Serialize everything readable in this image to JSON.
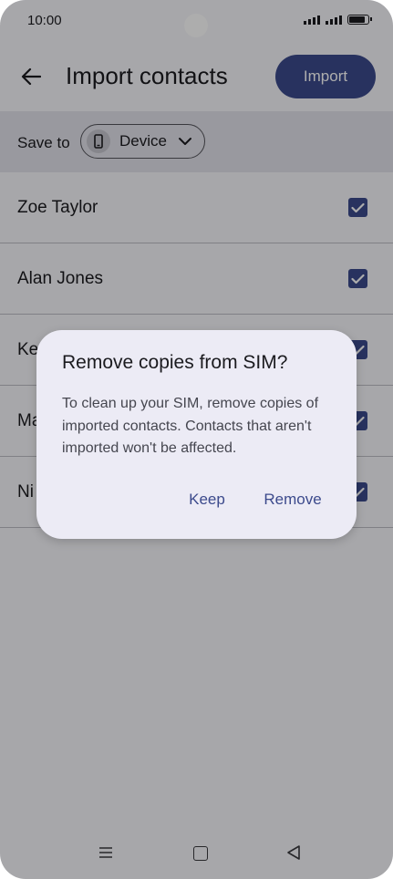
{
  "status_bar": {
    "time": "10:00"
  },
  "app_bar": {
    "title": "Import contacts",
    "import_label": "Import"
  },
  "save_to": {
    "label": "Save to",
    "destination": "Device"
  },
  "contacts": [
    {
      "name": "Zoe Taylor",
      "checked": true
    },
    {
      "name": "Alan Jones",
      "checked": true
    },
    {
      "name": "Ke",
      "checked": true
    },
    {
      "name": "Ma",
      "checked": true
    },
    {
      "name": "Ni",
      "checked": true
    }
  ],
  "dialog": {
    "title": "Remove copies from SIM?",
    "body": "To clean up your SIM, remove copies of imported contacts. Contacts that aren't imported won't be affected.",
    "keep_label": "Keep",
    "remove_label": "Remove"
  },
  "colors": {
    "accent": "#3c4a8c",
    "dialog_bg": "#ecebf5",
    "surface": "#f6f6fb"
  },
  "icons": [
    "back-arrow-icon",
    "phone-device-icon",
    "chevron-down-icon",
    "check-icon",
    "nav-menu-icon",
    "nav-home-icon",
    "nav-back-icon",
    "signal-icon",
    "battery-icon"
  ]
}
